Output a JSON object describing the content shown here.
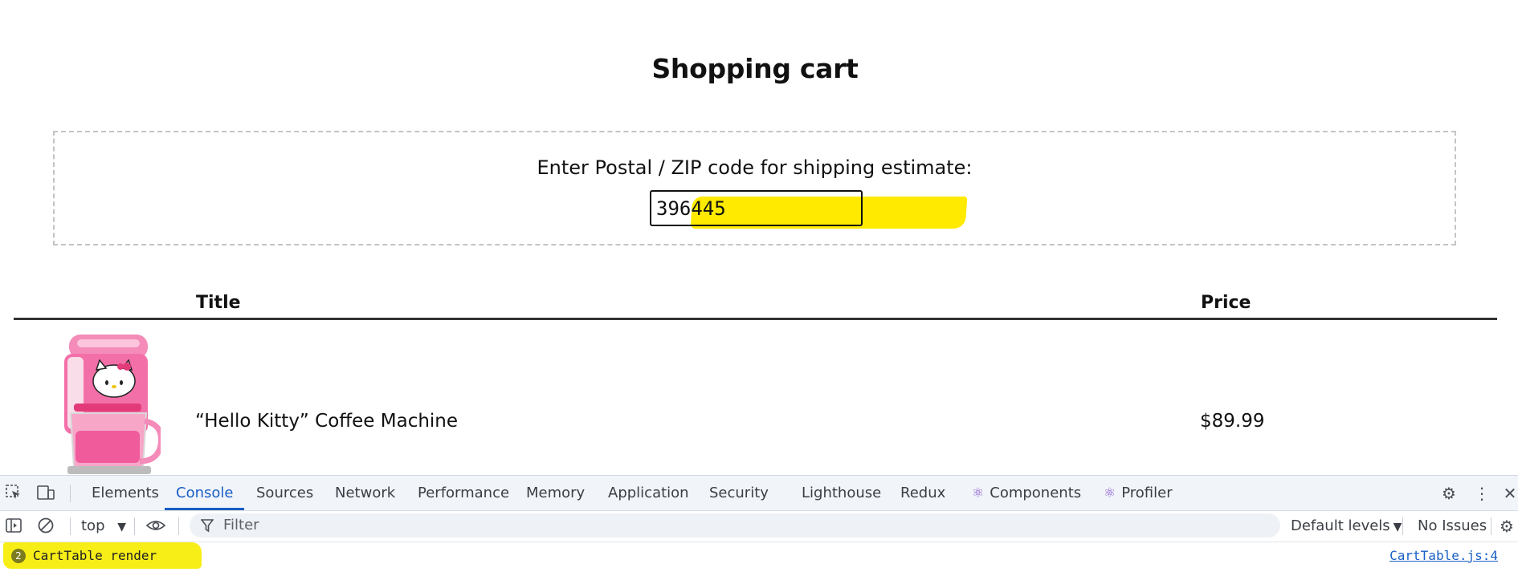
{
  "page": {
    "title": "Shopping cart",
    "shipping": {
      "label": "Enter Postal / ZIP code for shipping estimate:",
      "zip_value": "396445"
    },
    "table": {
      "headers": {
        "title": "Title",
        "price": "Price"
      },
      "rows": [
        {
          "title": "“Hello Kitty” Coffee Machine",
          "price": "$89.99",
          "image": "hello-kitty-coffee-machine"
        }
      ]
    }
  },
  "devtools": {
    "tabs": [
      {
        "label": "Elements",
        "active": false
      },
      {
        "label": "Console",
        "active": true
      },
      {
        "label": "Sources",
        "active": false
      },
      {
        "label": "Network",
        "active": false
      },
      {
        "label": "Performance",
        "active": false
      },
      {
        "label": "Memory",
        "active": false
      },
      {
        "label": "Application",
        "active": false
      },
      {
        "label": "Security",
        "active": false
      },
      {
        "label": "Lighthouse",
        "active": false
      },
      {
        "label": "Redux",
        "active": false
      },
      {
        "label": "Components",
        "active": false,
        "icon": "react-icon"
      },
      {
        "label": "Profiler",
        "active": false,
        "icon": "react-icon"
      }
    ],
    "toolbar": {
      "context": "top",
      "filter_placeholder": "Filter",
      "levels": "Default levels",
      "issues": "No Issues"
    },
    "messages": [
      {
        "count": "2",
        "text": "CartTable render",
        "source": "CartTable.js:4"
      }
    ],
    "colors": {
      "accent": "#1a5fc6",
      "highlight": "#ffea00"
    }
  }
}
